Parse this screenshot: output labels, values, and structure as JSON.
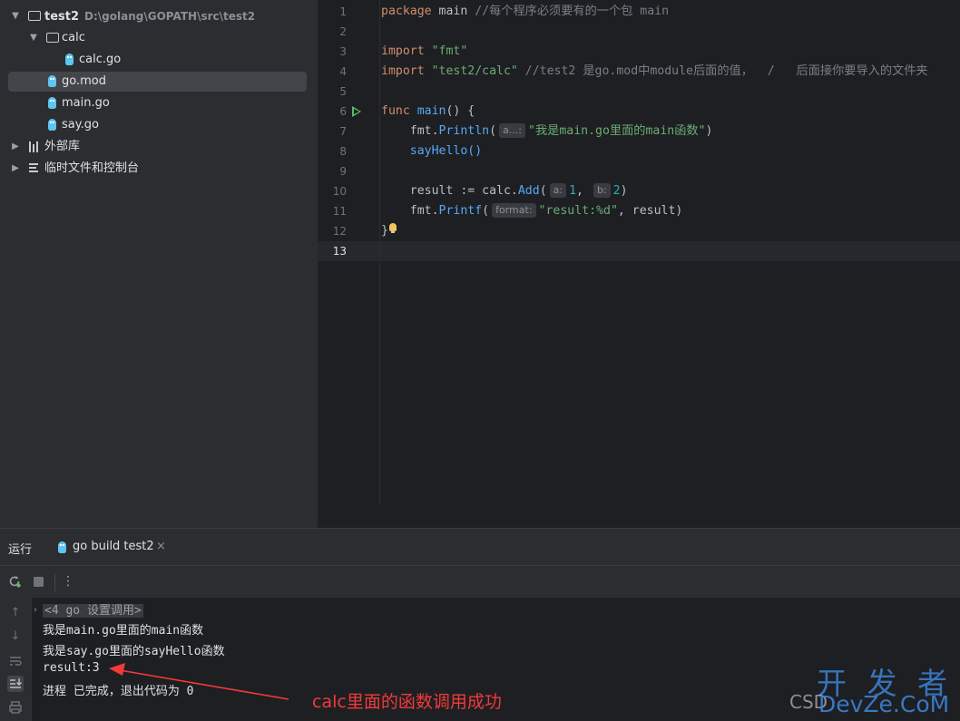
{
  "project_tree": {
    "root": {
      "name": "test2",
      "path": "D:\\golang\\GOPATH\\src\\test2"
    },
    "calc_folder": "calc",
    "calc_file": "calc.go",
    "gomod_file": "go.mod",
    "main_file": "main.go",
    "say_file": "say.go",
    "external_libs": "外部库",
    "scratches": "临时文件和控制台"
  },
  "editor": {
    "line_numbers": [
      "1",
      "2",
      "3",
      "4",
      "5",
      "6",
      "7",
      "8",
      "9",
      "10",
      "11",
      "12",
      "13"
    ],
    "lines": {
      "l1_kw": "package",
      "l1_name": " main ",
      "l1_comment": "//每个程序必须要有的一个包 main",
      "l3_kw": "import ",
      "l3_str": "\"fmt\"",
      "l4_kw": "import ",
      "l4_str": "\"test2/calc\"",
      "l4_comment": " //test2 是go.mod中module后面的值，  /   后面接你要导入的文件夹",
      "l6_kw": "func ",
      "l6_fn": "main",
      "l6_rest": "() {",
      "l7_pre": "    fmt.",
      "l7_fn": "Println",
      "l7_open": "(",
      "l7_hint": "a...:",
      "l7_str": "\"我是main.go里面的main函数\"",
      "l7_close": ")",
      "l8": "    sayHello()",
      "l10_pre": "    result := calc.",
      "l10_fn": "Add",
      "l10_open": "(",
      "l10_hint_a": "a:",
      "l10_a": "1",
      "l10_comma": ", ",
      "l10_hint_b": "b:",
      "l10_b": "2",
      "l10_close": ")",
      "l11_pre": "    fmt.",
      "l11_fn": "Printf",
      "l11_open": "(",
      "l11_hint": "format:",
      "l11_str": "\"result:%d\"",
      "l11_rest": ", result)",
      "l12": "}"
    }
  },
  "run_panel": {
    "title": "运行",
    "tab_label": "go build test2",
    "tab_close": "×",
    "more": "⋮",
    "console": {
      "call_header": "<4 go 设置调用>",
      "lines": [
        "我是main.go里面的main函数",
        "我是say.go里面的sayHello函数",
        "result:3",
        "进程 已完成，退出代码为 0"
      ]
    }
  },
  "annotation": {
    "text": "calc里面的函数调用成功",
    "color": "#f23a3a"
  },
  "watermark": {
    "top": "开 发 者",
    "left": "CSD",
    "bottom": "DevZe.CoM"
  }
}
